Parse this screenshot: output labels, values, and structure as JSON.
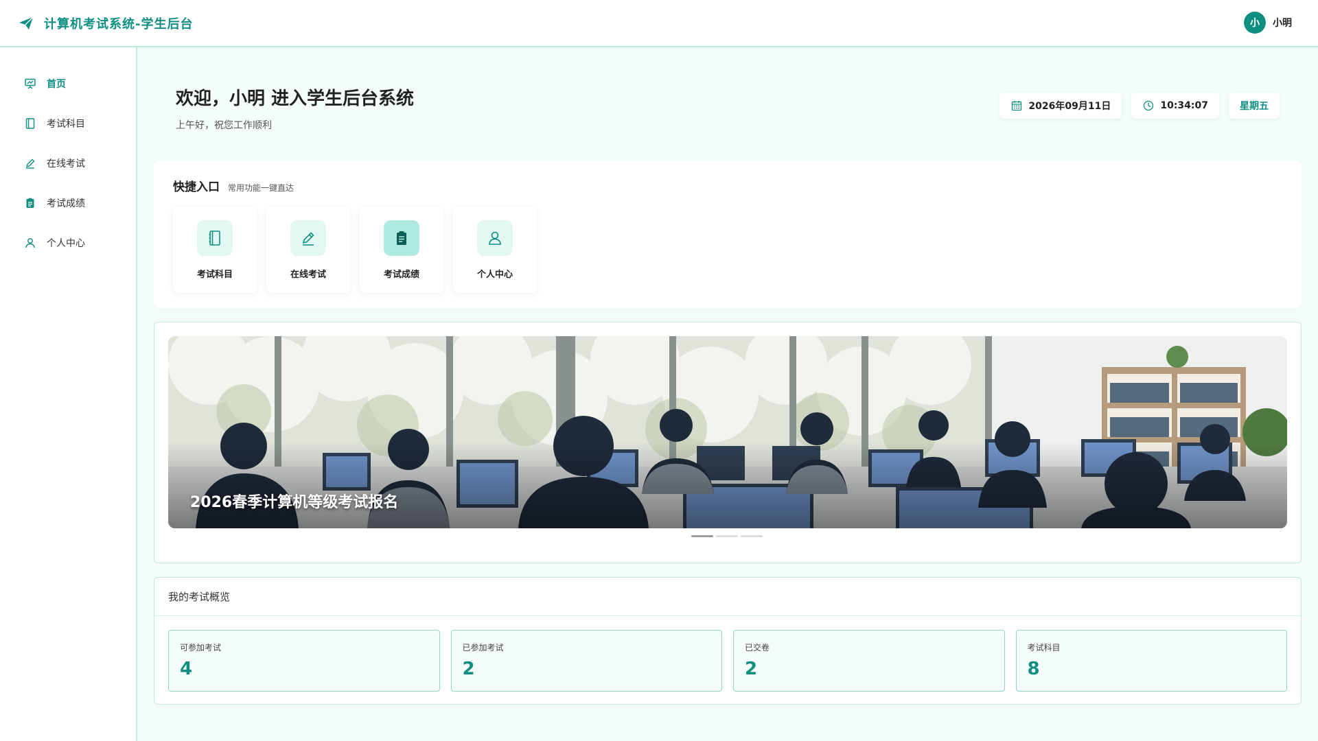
{
  "app": {
    "title": "计算机考试系统-学生后台"
  },
  "user": {
    "avatar_letter": "小",
    "name": "小明"
  },
  "sidebar": {
    "items": [
      {
        "label": "首页",
        "icon": "presentation-icon",
        "active": true
      },
      {
        "label": "考试科目",
        "icon": "notebook-icon"
      },
      {
        "label": "在线考试",
        "icon": "pen-icon"
      },
      {
        "label": "考试成绩",
        "icon": "clipboard-icon"
      },
      {
        "label": "个人中心",
        "icon": "user-icon"
      }
    ]
  },
  "welcome": {
    "title": "欢迎，小明 进入学生后台系统",
    "subtitle": "上午好，祝您工作顺利",
    "date": "2026年09月11日",
    "time": "10:34:07",
    "weekday": "星期五"
  },
  "quick": {
    "title": "快捷入口",
    "subtitle": "常用功能一键直达",
    "items": [
      {
        "label": "考试科目",
        "icon": "notebook-icon"
      },
      {
        "label": "在线考试",
        "icon": "pen-icon"
      },
      {
        "label": "考试成绩",
        "icon": "clipboard-icon",
        "active": true
      },
      {
        "label": "个人中心",
        "icon": "user-icon"
      }
    ]
  },
  "banner": {
    "caption": "2026春季计算机等级考试报名",
    "slides": 3,
    "active_slide": 1
  },
  "overview": {
    "title": "我的考试概览",
    "stats": [
      {
        "label": "可参加考试",
        "value": "4"
      },
      {
        "label": "已参加考试",
        "value": "2"
      },
      {
        "label": "已交卷",
        "value": "2"
      },
      {
        "label": "考试科目",
        "value": "8"
      }
    ]
  },
  "colors": {
    "accent": "#0f8f82",
    "border": "#bfe9e1",
    "background": "#f1fbf9"
  }
}
